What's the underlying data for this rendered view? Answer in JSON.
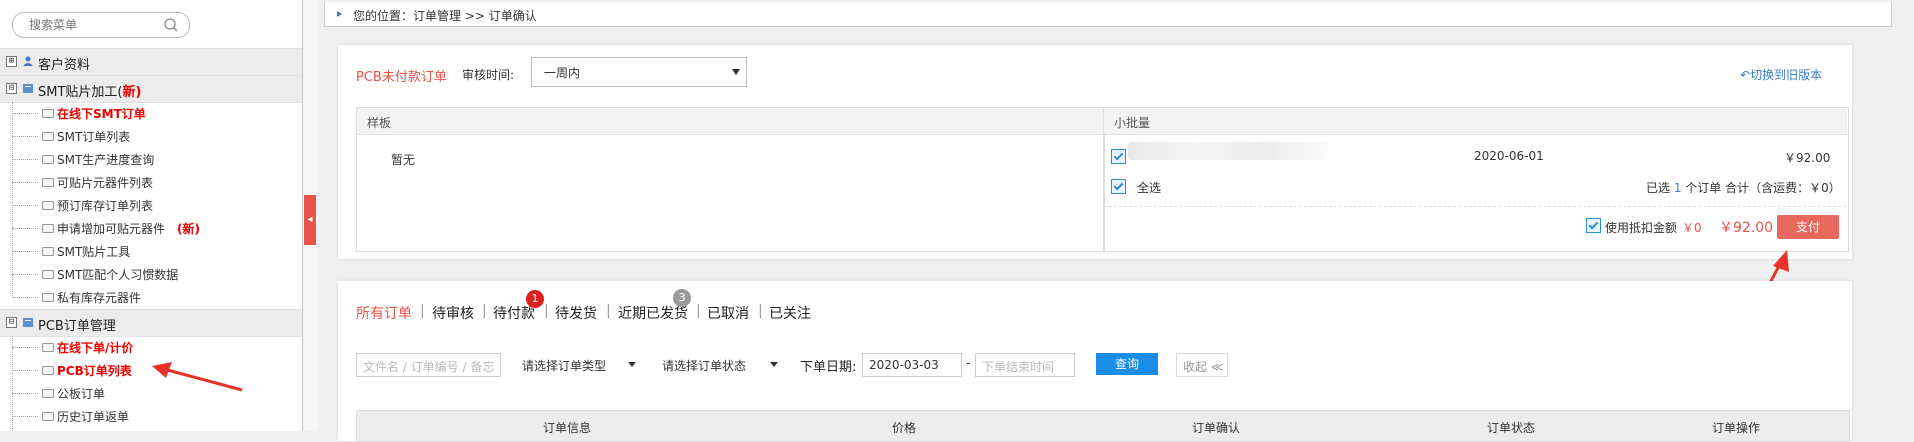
{
  "sidebar": {
    "search_placeholder": "搜索菜单",
    "groups": [
      {
        "label": "客户资料",
        "new": ""
      },
      {
        "label": "SMT贴片加工(",
        "new": "新)"
      },
      {
        "label": "PCB订单管理",
        "new": ""
      }
    ],
    "smt_items": [
      {
        "label": "在线下SMT订单"
      },
      {
        "label": "SMT订单列表"
      },
      {
        "label": "SMT生产进度查询"
      },
      {
        "label": "可贴片元器件列表"
      },
      {
        "label": "预订库存订单列表"
      },
      {
        "label": "申请增加可贴元器件",
        "new": "(新)"
      },
      {
        "label": "SMT贴片工具"
      },
      {
        "label": "SMT匹配个人习惯数据"
      },
      {
        "label": "私有库存元器件"
      }
    ],
    "pcb_items": [
      {
        "label": "在线下单/计价"
      },
      {
        "label": "PCB订单列表"
      },
      {
        "label": "公板订单"
      },
      {
        "label": "历史订单返单"
      }
    ],
    "toggle_symbol": "⊟",
    "toggle_symbol_collapsed": "⊞"
  },
  "collapse_arrow": "◂",
  "breadcrumb": "您的位置：订单管理 >> 订单确认",
  "panel1": {
    "title": "PCB未付款订单",
    "review_time_label": "审核时间:",
    "review_time_value": "一周内",
    "switch_version": "切换到旧版本",
    "sample_header": "样板",
    "sample_empty": "暂无",
    "small_batch_header": "小批量",
    "order_date": "2020-06-01",
    "order_price": "￥92.00",
    "select_all": "全选",
    "selected_summary": {
      "prefix": "已选 ",
      "count": "1",
      "middle": " 个订单 合计（含运费：￥0）"
    },
    "use_deduction_label": "使用抵扣金额",
    "deduction_value": "￥0",
    "total": "￥92.00",
    "pay_button": "支付"
  },
  "tabs": [
    {
      "label": "所有订单",
      "active": true
    },
    {
      "label": "待审核"
    },
    {
      "label": "待付款",
      "badge": "1"
    },
    {
      "label": "待发货"
    },
    {
      "label": "近期已发货",
      "badge": "3"
    },
    {
      "label": "已取消"
    },
    {
      "label": "已关注"
    }
  ],
  "filters": {
    "search_placeholder": "文件名 / 订单编号 / 备忘",
    "order_type": "请选择订单类型",
    "order_status": "请选择订单状态",
    "date_label": "下单日期:",
    "date_start": "2020-03-03",
    "date_sep": "-",
    "date_end_placeholder": "下单结束时间",
    "query_button": "查询",
    "collapse_label": "收起 ≪"
  },
  "table_headers": [
    "订单信息",
    "价格",
    "订单确认",
    "订单状态",
    "订单操作"
  ],
  "colors": {
    "accent_red": "#e8534a",
    "new_red": "#ee0000",
    "blue": "#1a8de6",
    "badge_red": "#e02020",
    "badge_gray": "#999999"
  }
}
